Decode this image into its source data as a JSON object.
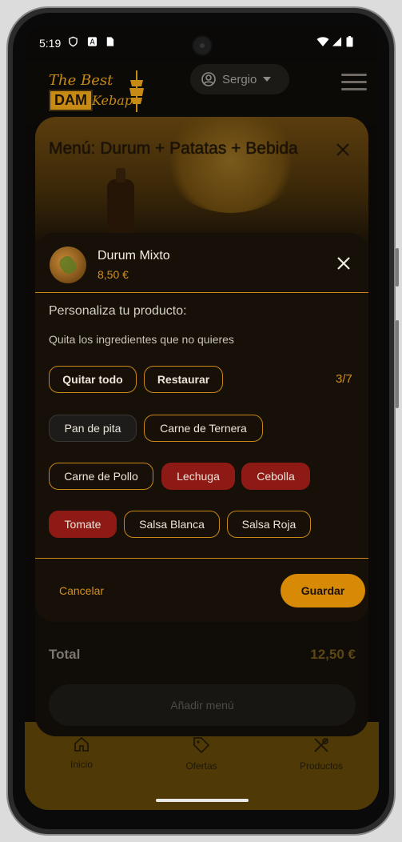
{
  "status": {
    "time": "5:19"
  },
  "header": {
    "logo_top": "The Best",
    "logo_dam": "DAM",
    "logo_bottom": "Kebap",
    "user": "Sergio"
  },
  "menu": {
    "title": "Menú: Durum + Patatas + Bebida",
    "total_label": "Total",
    "total_value": "12,50 €",
    "add_button": "Añadir menú"
  },
  "dialog": {
    "product_name": "Durum Mixto",
    "product_price": "8,50 €",
    "title": "Personaliza tu producto:",
    "subtitle": "Quita los ingredientes que no quieres",
    "remove_all": "Quitar todo",
    "restore": "Restaurar",
    "counter": "3/7",
    "ingredients": [
      {
        "label": "Pan de pita",
        "state": "fixed"
      },
      {
        "label": "Carne de Ternera",
        "state": "selected"
      },
      {
        "label": "Carne de Pollo",
        "state": "selected"
      },
      {
        "label": "Lechuga",
        "state": "removed"
      },
      {
        "label": "Cebolla",
        "state": "removed"
      },
      {
        "label": "Tomate",
        "state": "removed"
      },
      {
        "label": "Salsa Blanca",
        "state": "selected"
      },
      {
        "label": "Salsa Roja",
        "state": "selected"
      }
    ],
    "cancel": "Cancelar",
    "save": "Guardar"
  },
  "bottom_nav": [
    {
      "label": "Inicio",
      "icon": "home-icon"
    },
    {
      "label": "Ofertas",
      "icon": "tag-icon"
    },
    {
      "label": "Productos",
      "icon": "cutlery-icon"
    }
  ],
  "colors": {
    "accent": "#d68a05",
    "removed": "#8e1a15",
    "text": "#f3ede3"
  }
}
